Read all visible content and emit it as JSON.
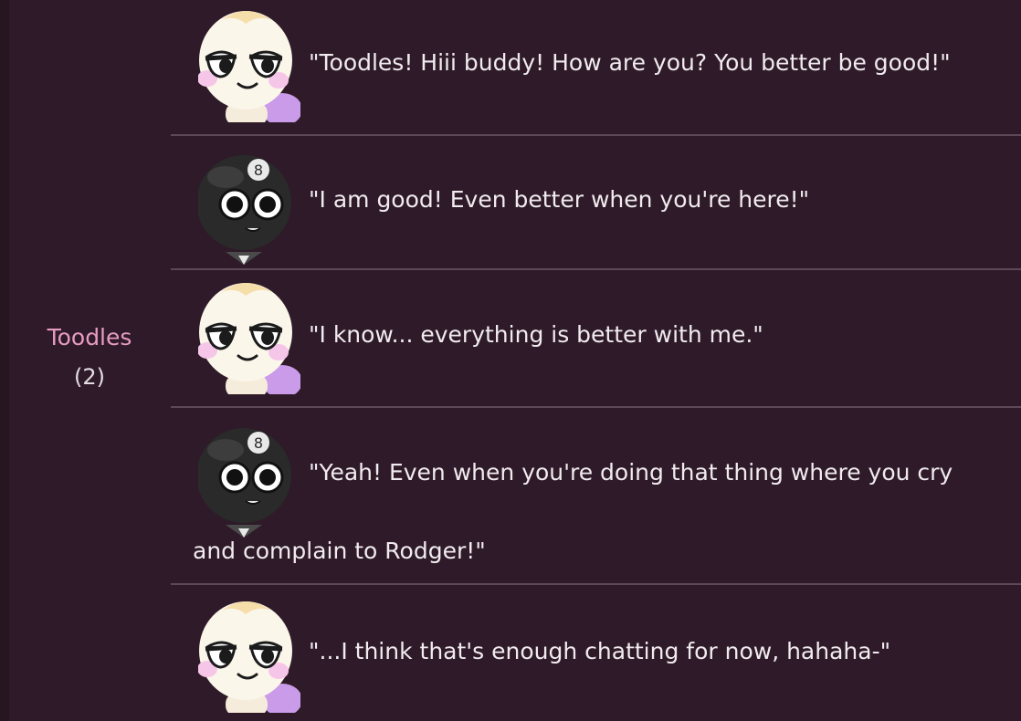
{
  "speaker": {
    "name": "Toodles",
    "count": "(2)"
  },
  "colors": {
    "background": "#2e1a28",
    "speaker_name": "#e79bc0",
    "text": "#f1ebef",
    "divider": "#5d4857"
  },
  "dialogue": [
    {
      "avatar": "toodles-avatar-icon",
      "text": "\"Toodles! Hiii buddy! How are you? You better be good!\""
    },
    {
      "avatar": "eight-ball-avatar-icon",
      "text": "\"I am good! Even better when you're here!\""
    },
    {
      "avatar": "toodles-avatar-icon",
      "text": "\"I know... everything is better with me.\""
    },
    {
      "avatar": "eight-ball-avatar-icon",
      "text": "\"Yeah! Even when you're doing that thing where you cry",
      "continuation": "and complain to Rodger!\""
    },
    {
      "avatar": "toodles-avatar-icon",
      "text": "\"...I think that's enough chatting for now, hahaha-\""
    }
  ]
}
